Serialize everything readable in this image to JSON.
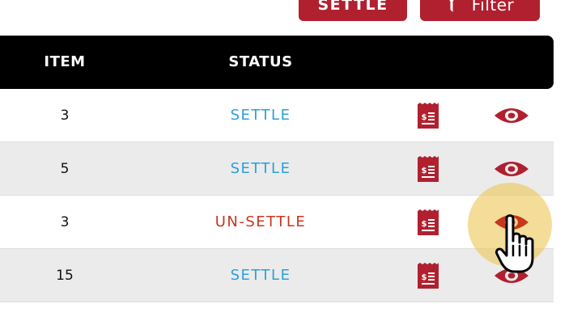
{
  "toolbar": {
    "settle_label": "SETTLE",
    "filter_label": "Filter"
  },
  "table": {
    "headers": {
      "item": "ITEM",
      "status": "STATUS"
    },
    "rows": [
      {
        "item": "3",
        "status": "SETTLE",
        "status_kind": "settle"
      },
      {
        "item": "5",
        "status": "SETTLE",
        "status_kind": "settle"
      },
      {
        "item": "3",
        "status": "UN-SETTLE",
        "status_kind": "unsettle"
      },
      {
        "item": "15",
        "status": "SETTLE",
        "status_kind": "settle"
      }
    ]
  },
  "icons": {
    "receipt": "receipt-icon",
    "view": "eye-icon",
    "filter": "funnel-icon",
    "cursor": "hand-pointer-icon"
  },
  "colors": {
    "brand": "#b0202f",
    "header_bg": "#000000",
    "settle": "#2ba0d8",
    "unsettle": "#c8361f",
    "highlight": "#eec85a"
  }
}
